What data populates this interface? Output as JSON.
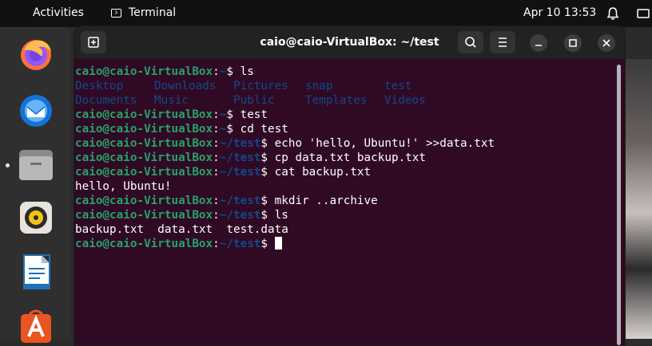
{
  "topbar": {
    "activities": "Activities",
    "app_name": "Terminal",
    "clock": "Apr 10  13:53"
  },
  "dock": {
    "items": [
      "firefox-icon",
      "thunderbird-icon",
      "files-icon",
      "rhythmbox-icon",
      "libreoffice-writer-icon",
      "software-store-icon"
    ]
  },
  "window": {
    "title": "caio@caio-VirtualBox: ~/test"
  },
  "terminal": {
    "prompt_user": "caio@caio-VirtualBox",
    "home": "~",
    "test_dir": "~/test",
    "cmd1": "ls",
    "ls_home": [
      [
        "Desktop",
        "Downloads",
        "Pictures",
        "snap",
        "test"
      ],
      [
        "Documents",
        "Music",
        "Public",
        "Templates",
        "Videos"
      ]
    ],
    "cmd2": "test",
    "cmd3": "cd test",
    "cmd4": "echo 'hello, Ubuntu!' >>data.txt",
    "cmd5": "cp data.txt backup.txt",
    "cmd6": "cat backup.txt",
    "out6": "hello, Ubuntu!",
    "cmd7": "mkdir ..archive",
    "cmd8": "ls",
    "out8": "backup.txt  data.txt  test.data"
  },
  "colors": {
    "terminal_bg": "#300a24",
    "prompt_user": "#26a269",
    "prompt_path": "#12488b",
    "header_bg": "#222222"
  }
}
